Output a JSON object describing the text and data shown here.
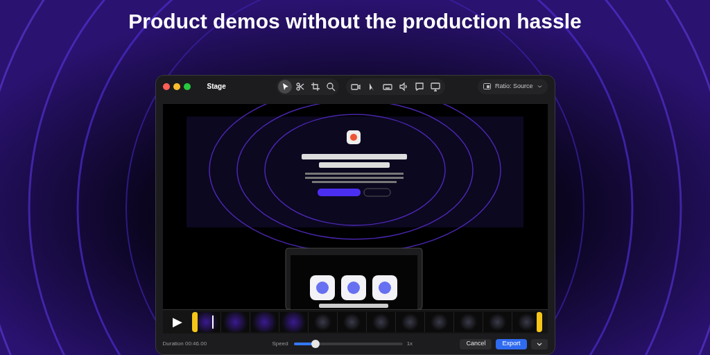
{
  "headline": "Product demos without the production hassle",
  "window": {
    "title": "Stage"
  },
  "tools": [
    {
      "selected": true
    },
    {
      "selected": false
    },
    {
      "selected": false
    },
    {
      "selected": false
    }
  ],
  "ratio": {
    "label": "Ratio: Source"
  },
  "timeline": {
    "play": "▶"
  },
  "footer": {
    "duration": "Duration 00:46.00",
    "speed_label": "Speed",
    "speed": {
      "level": 0.2
    },
    "speed_value": "1x",
    "buttons": [
      {
        "label": "Cancel",
        "kind": "secondary"
      },
      {
        "label": "Export",
        "kind": "primary"
      }
    ]
  }
}
